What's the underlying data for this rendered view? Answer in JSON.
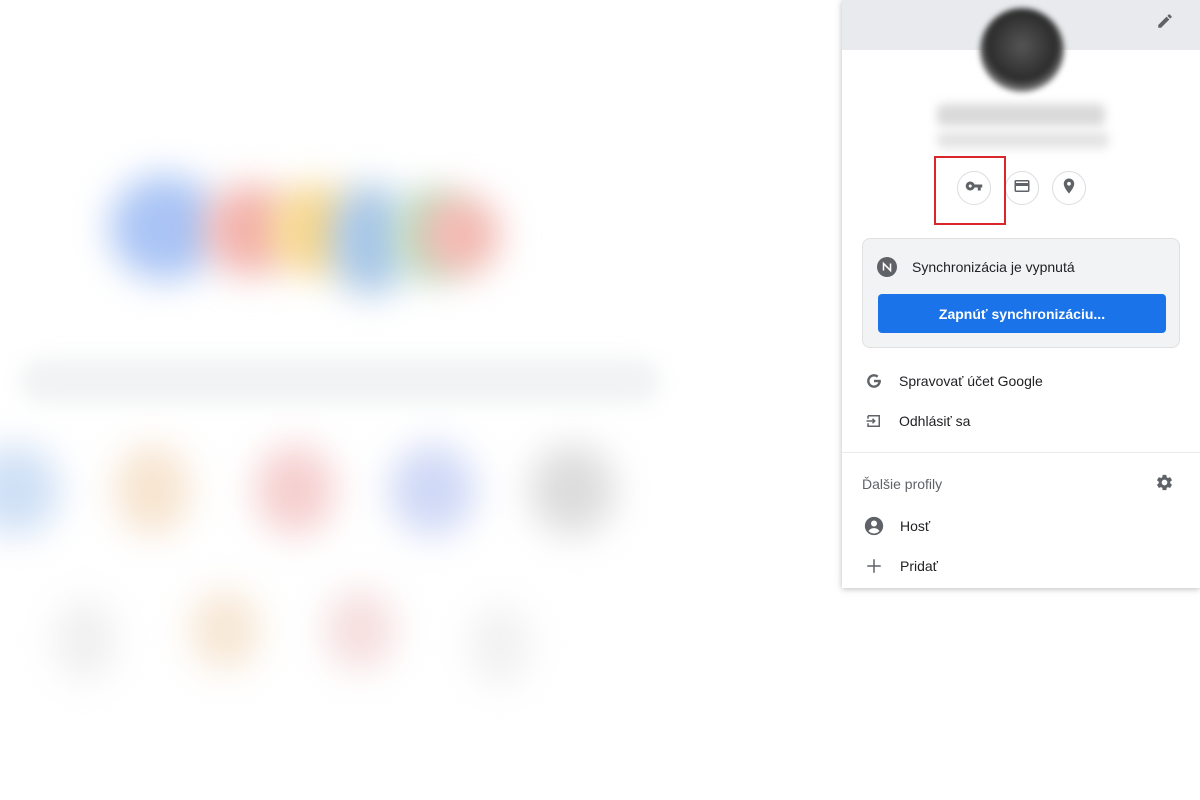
{
  "profile_menu": {
    "edit_icon": "pencil-icon",
    "quick_actions": [
      {
        "name": "passwords",
        "icon": "key-icon"
      },
      {
        "name": "payment-methods",
        "icon": "credit-card-icon"
      },
      {
        "name": "addresses",
        "icon": "location-pin-icon"
      }
    ],
    "sync": {
      "status_text": "Synchronizácia je vypnutá",
      "status_icon": "sync-off-icon",
      "button_label": "Zapnúť synchronizáciu..."
    },
    "items": {
      "manage_account": "Spravovať účet Google",
      "sign_out": "Odhlásiť sa"
    },
    "other_profiles": {
      "title": "Ďalšie profily",
      "settings_icon": "gear-icon",
      "guest_label": "Hosť",
      "add_label": "Pridať"
    },
    "highlight_color": "#d9262b",
    "accent_color": "#1a73e8"
  }
}
